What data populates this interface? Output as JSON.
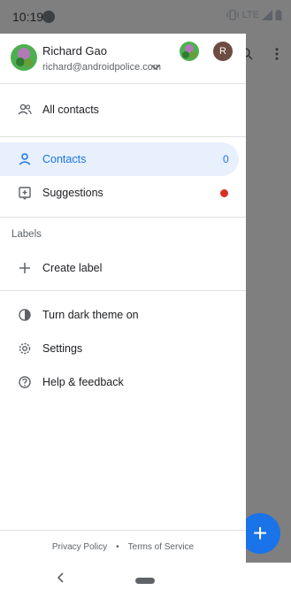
{
  "status_bar": {
    "time": "10:19",
    "network": "LTE"
  },
  "account": {
    "name": "Richard Gao",
    "email": "richard@androidpolice.com",
    "other_account_initial": "R"
  },
  "nav": {
    "all_contacts": "All contacts",
    "contacts": "Contacts",
    "contacts_count": "0",
    "suggestions": "Suggestions"
  },
  "labels": {
    "section_title": "Labels",
    "create_label": "Create label"
  },
  "more": {
    "dark_theme": "Turn dark theme on",
    "settings": "Settings",
    "help": "Help & feedback"
  },
  "footer": {
    "privacy": "Privacy Policy",
    "separator": "•",
    "terms": "Terms of Service"
  },
  "colors": {
    "accent": "#1a73e8",
    "active_bg": "#e8f0fe",
    "badge_red": "#d93025",
    "other_avatar_bg": "#6d4c41"
  },
  "icons": [
    "spotify-icon",
    "vibrate-icon",
    "signal-icon",
    "battery-icon",
    "chevron-down-icon",
    "people-icon",
    "person-icon",
    "add-box-icon",
    "plus-icon",
    "contrast-icon",
    "gear-icon",
    "help-icon",
    "search-icon",
    "more-vert-icon",
    "back-icon",
    "home-pill-icon"
  ]
}
